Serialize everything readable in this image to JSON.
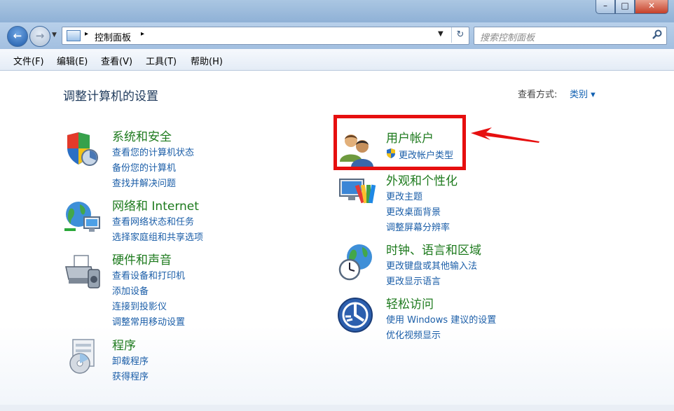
{
  "window": {
    "minimize": "–",
    "maximize": "□",
    "close": "✕"
  },
  "address_bar": {
    "crumb_sep1": "▸",
    "path": "控制面板",
    "crumb_sep2": "▸",
    "dropdown": "▼",
    "refresh": "↻"
  },
  "search": {
    "placeholder": "搜索控制面板"
  },
  "menu": [
    {
      "label": "文件(F)"
    },
    {
      "label": "编辑(E)"
    },
    {
      "label": "查看(V)"
    },
    {
      "label": "工具(T)"
    },
    {
      "label": "帮助(H)"
    }
  ],
  "page": {
    "title": "调整计算机的设置",
    "view_by_label": "查看方式:",
    "view_by_value": "类别 ▾"
  },
  "categories": [
    {
      "title": "系统和安全",
      "icon": "shield-icon",
      "links": [
        "查看您的计算机状态",
        "备份您的计算机",
        "查找并解决问题"
      ]
    },
    {
      "title": "网络和 Internet",
      "icon": "network-globe-icon",
      "links": [
        "查看网络状态和任务",
        "选择家庭组和共享选项"
      ]
    },
    {
      "title": "硬件和声音",
      "icon": "printer-icon",
      "links": [
        "查看设备和打印机",
        "添加设备",
        "连接到投影仪",
        "调整常用移动设置"
      ]
    },
    {
      "title": "程序",
      "icon": "programs-disc-icon",
      "links": [
        "卸载程序",
        "获得程序"
      ]
    },
    {
      "title": "用户帐户",
      "icon": "users-icon",
      "links": [
        "更改帐户类型"
      ]
    },
    {
      "title": "外观和个性化",
      "icon": "display-palette-icon",
      "links": [
        "更改主题",
        "更改桌面背景",
        "调整屏幕分辨率"
      ]
    },
    {
      "title": "时钟、语言和区域",
      "icon": "clock-globe-icon",
      "links": [
        "更改键盘或其他输入法",
        "更改显示语言"
      ]
    },
    {
      "title": "轻松访问",
      "icon": "ease-of-access-icon",
      "links": [
        "使用 Windows 建议的设置",
        "优化视频显示"
      ]
    }
  ],
  "colors": {
    "category_title": "#1d7a1d",
    "link": "#1b5ea8",
    "highlight": "#e60f0f"
  }
}
